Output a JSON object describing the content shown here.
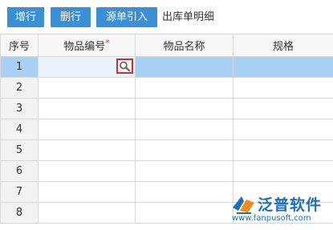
{
  "toolbar": {
    "add_row_label": "增行",
    "delete_row_label": "删行",
    "source_import_label": "源单引入",
    "title": "出库单明细"
  },
  "grid": {
    "columns": {
      "seq": "序号",
      "code": "物品编号",
      "code_required_mark": "*",
      "name": "物品名称",
      "spec": "规格"
    },
    "rows": [
      {
        "seq": "1",
        "code": "",
        "name": "",
        "spec": ""
      },
      {
        "seq": "2",
        "code": "",
        "name": "",
        "spec": ""
      },
      {
        "seq": "3",
        "code": "",
        "name": "",
        "spec": ""
      },
      {
        "seq": "4",
        "code": "",
        "name": "",
        "spec": ""
      },
      {
        "seq": "5",
        "code": "",
        "name": "",
        "spec": ""
      },
      {
        "seq": "6",
        "code": "",
        "name": "",
        "spec": ""
      },
      {
        "seq": "7",
        "code": "",
        "name": "",
        "spec": ""
      },
      {
        "seq": "8",
        "code": "",
        "name": "",
        "spec": ""
      }
    ],
    "selected_row": 1
  },
  "watermark": {
    "brand": "泛普软件",
    "url": "www.fanpusoft.com",
    "icon": "fanpu-logo-icon"
  },
  "colors": {
    "button": "#3a8fd6",
    "selected_row": "#a9d0f5",
    "lookup_highlight": "#e0262b",
    "watermark": "#1f6fb7"
  }
}
